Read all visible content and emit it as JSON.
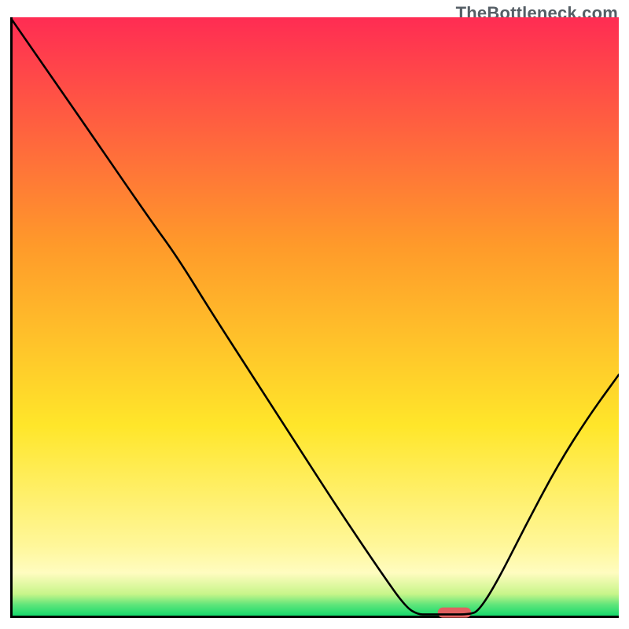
{
  "watermark": "TheBottleneck.com",
  "chart_data": {
    "type": "line",
    "title": "",
    "xlabel": "",
    "ylabel": "",
    "x_range": [
      0,
      100
    ],
    "y_range": [
      0,
      100
    ],
    "background_gradient": {
      "top_color": "#ff2c53",
      "mid_color_upper": "#ff9a2a",
      "mid_color_lower": "#ffe62a",
      "band_color": "#fffcc0",
      "bottom_color": "#07d76a"
    },
    "curve_points_xy": [
      [
        0.0,
        100.0
      ],
      [
        7.7,
        88.8
      ],
      [
        15.3,
        77.6
      ],
      [
        23.0,
        66.3
      ],
      [
        27.5,
        60.0
      ],
      [
        33.0,
        51.0
      ],
      [
        40.0,
        40.0
      ],
      [
        47.0,
        29.0
      ],
      [
        54.0,
        18.0
      ],
      [
        61.0,
        7.5
      ],
      [
        65.0,
        1.8
      ],
      [
        67.0,
        0.6
      ],
      [
        68.5,
        0.6
      ],
      [
        72.0,
        0.6
      ],
      [
        75.5,
        0.6
      ],
      [
        77.0,
        1.2
      ],
      [
        80.0,
        6.0
      ],
      [
        85.0,
        16.0
      ],
      [
        90.0,
        25.5
      ],
      [
        95.0,
        33.5
      ],
      [
        100.0,
        40.5
      ]
    ],
    "marker": {
      "x_center": 73.0,
      "y_center": 0.9,
      "width_x_units": 5.5,
      "height_y_units": 1.7,
      "color": "#e16060"
    },
    "axes": {
      "left_visible": true,
      "bottom_visible": true,
      "stroke": "#000000",
      "stroke_width": 3
    }
  }
}
